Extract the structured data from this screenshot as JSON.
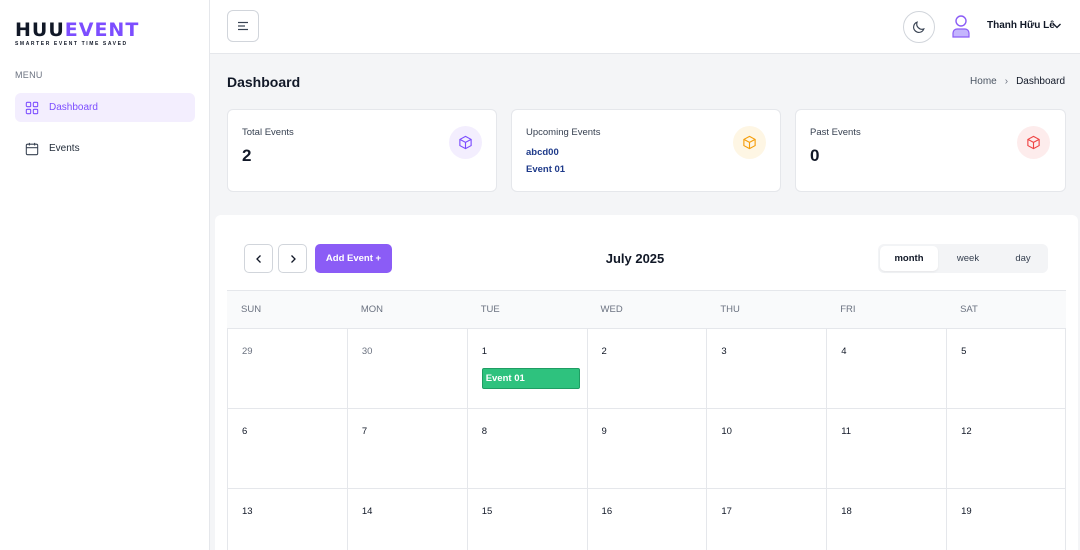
{
  "app": {
    "logo_main": "HUU",
    "logo_accent": "EVENT",
    "logo_tagline": "SMARTER EVENT TIME SAVED"
  },
  "sidebar": {
    "menu_label": "MENU",
    "items": [
      {
        "label": "Dashboard",
        "icon": "grid-icon",
        "active": true
      },
      {
        "label": "Events",
        "icon": "calendar-icon",
        "active": false
      }
    ]
  },
  "header": {
    "user_name": "Thanh Hữu Lê"
  },
  "page": {
    "title": "Dashboard",
    "breadcrumb": [
      "Home",
      "Dashboard"
    ]
  },
  "stats": {
    "total": {
      "label": "Total Events",
      "value": "2",
      "icon_color": "#7c4dff"
    },
    "upcoming": {
      "label": "Upcoming Events",
      "items": [
        "abcd00",
        "Event 01"
      ],
      "icon_color": "#f59e0b"
    },
    "past": {
      "label": "Past Events",
      "value": "0",
      "icon_color": "#ef4444"
    }
  },
  "calendar": {
    "title": "July 2025",
    "add_event_label": "Add Event +",
    "views": [
      "month",
      "week",
      "day"
    ],
    "active_view": "month",
    "weekdays": [
      "SUN",
      "MON",
      "TUE",
      "WED",
      "THU",
      "FRI",
      "SAT"
    ],
    "weeks": [
      [
        "29",
        "30",
        "1",
        "2",
        "3",
        "4",
        "5"
      ],
      [
        "6",
        "7",
        "8",
        "9",
        "10",
        "11",
        "12"
      ],
      [
        "13",
        "14",
        "15",
        "16",
        "17",
        "18",
        "19"
      ]
    ],
    "events": [
      {
        "label": "Event 01",
        "day": "1",
        "color": "#2ec27e"
      }
    ]
  },
  "colors": {
    "accent": "#8b5cf6",
    "event": "#2ec27e"
  }
}
